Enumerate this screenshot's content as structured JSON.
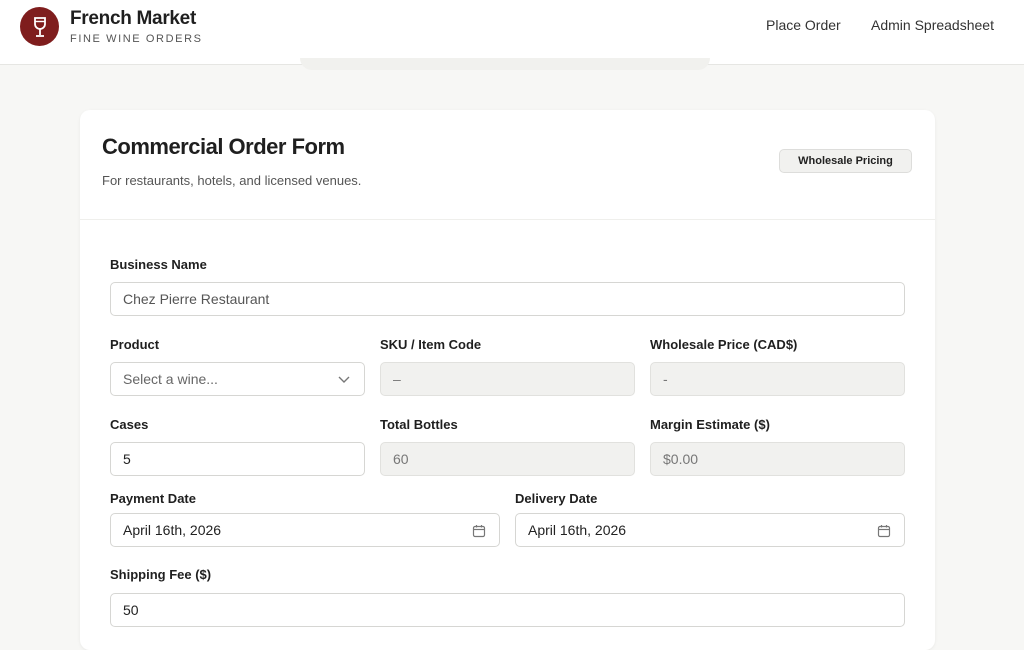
{
  "header": {
    "brand_name": "French Market",
    "brand_tagline": "FINE WINE ORDERS",
    "logo_icon": "wine-glass-icon",
    "logo_color": "#7f1d1d",
    "nav": [
      {
        "label": "Place Order"
      },
      {
        "label": "Admin Spreadsheet"
      }
    ]
  },
  "form": {
    "title": "Commercial Order Form",
    "subtitle": "For restaurants, hotels, and licensed venues.",
    "badge": "Wholesale Pricing",
    "business_name": {
      "label": "Business Name",
      "value": "Chez Pierre Restaurant"
    },
    "product": {
      "label": "Product",
      "placeholder": "Select a wine...",
      "icon": "chevron-down-icon"
    },
    "sku": {
      "label": "SKU / Item Code",
      "value": "–"
    },
    "wholesale_price": {
      "label": "Wholesale Price (CAD$)",
      "value": "-"
    },
    "cases": {
      "label": "Cases",
      "value": "5"
    },
    "total_bottles": {
      "label": "Total Bottles",
      "value": "60"
    },
    "margin_estimate": {
      "label": "Margin Estimate ($)",
      "value": "$0.00"
    },
    "payment_date": {
      "label": "Payment Date",
      "value": "April 16th, 2026",
      "icon": "calendar-icon"
    },
    "delivery_date": {
      "label": "Delivery Date",
      "value": "April 16th, 2026",
      "icon": "calendar-icon"
    },
    "shipping_fee": {
      "label": "Shipping Fee ($)",
      "value": "50"
    }
  }
}
